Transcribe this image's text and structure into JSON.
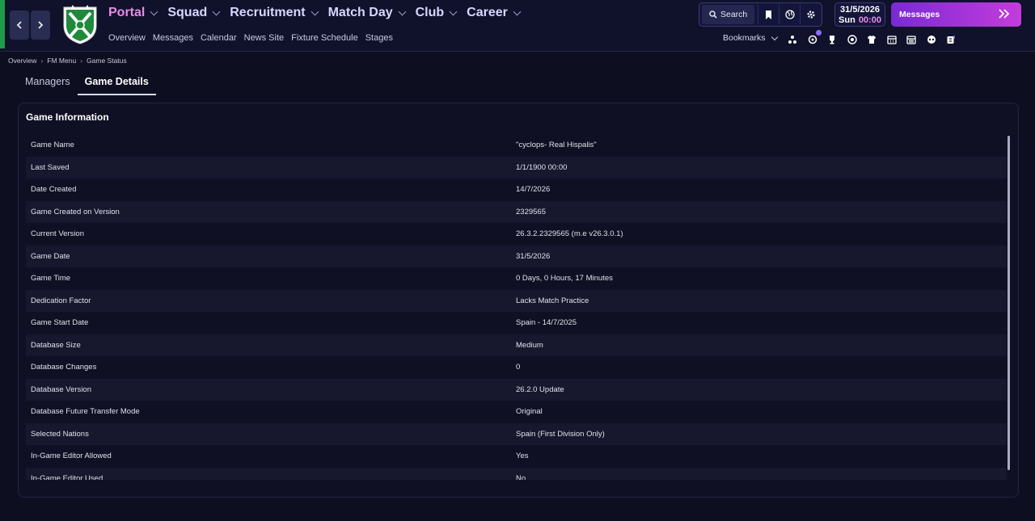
{
  "nav": {
    "main": [
      {
        "label": "Portal",
        "active": true
      },
      {
        "label": "Squad",
        "active": false
      },
      {
        "label": "Recruitment",
        "active": false
      },
      {
        "label": "Match Day",
        "active": false
      },
      {
        "label": "Club",
        "active": false
      },
      {
        "label": "Career",
        "active": false
      }
    ],
    "sub": [
      "Overview",
      "Messages",
      "Calendar",
      "News Site",
      "Fixture Schedule",
      "Stages"
    ]
  },
  "toolbar": {
    "search_label": "Search",
    "date": "31/5/2026",
    "day": "Sun",
    "time": "00:00",
    "messages_label": "Messages",
    "bookmarks_label": "Bookmarks"
  },
  "breadcrumb": [
    "Overview",
    "FM Menu",
    "Game Status"
  ],
  "tabs": [
    {
      "label": "Managers",
      "active": false
    },
    {
      "label": "Game Details",
      "active": true
    }
  ],
  "panel": {
    "title": "Game Information",
    "rows": [
      {
        "key": "Game Name",
        "value": "\"cyclops- Real Hispalis\""
      },
      {
        "key": "Last Saved",
        "value": "1/1/1900 00:00"
      },
      {
        "key": "Date Created",
        "value": "14/7/2026"
      },
      {
        "key": "Game Created on Version",
        "value": "2329565"
      },
      {
        "key": "Current Version",
        "value": "26.3.2.2329565 (m.e v26.3.0.1)"
      },
      {
        "key": "Game Date",
        "value": "31/5/2026"
      },
      {
        "key": "Game Time",
        "value": "0 Days, 0 Hours, 17 Minutes"
      },
      {
        "key": "Dedication Factor",
        "value": "Lacks Match Practice"
      },
      {
        "key": "Game Start Date",
        "value": "Spain - 14/7/2025"
      },
      {
        "key": "Database Size",
        "value": "Medium"
      },
      {
        "key": "Database Changes",
        "value": "0"
      },
      {
        "key": "Database Version",
        "value": "26.2.0 Update"
      },
      {
        "key": "Database Future Transfer Mode",
        "value": "Original"
      },
      {
        "key": "Selected Nations",
        "value": "Spain (First Division Only)"
      },
      {
        "key": "In-Game Editor Allowed",
        "value": "Yes"
      },
      {
        "key": "In-Game Editor Used",
        "value": "No"
      }
    ]
  },
  "colors": {
    "accent": "#e98be9",
    "background": "#0d0e1f",
    "messages_gradient_start": "#7a2ad4",
    "messages_gradient_end": "#c43cdc",
    "club_green": "#1f9a49"
  }
}
